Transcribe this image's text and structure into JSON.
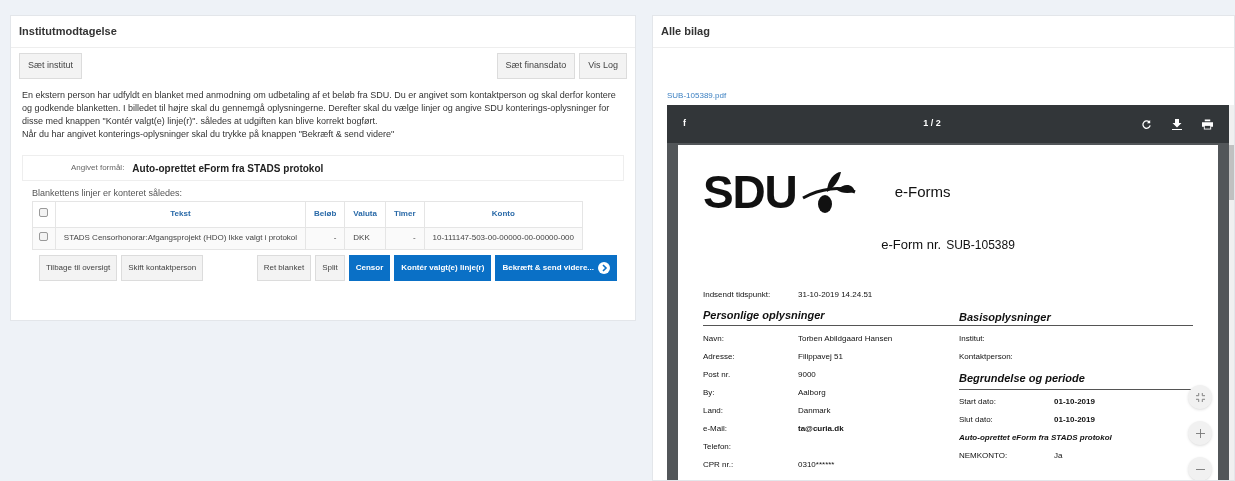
{
  "left_panel": {
    "title": "Institutmodtagelse",
    "toolbar_left": [
      "Sæt institut"
    ],
    "toolbar_right": [
      "Sæt finansdato",
      "Vis Log"
    ],
    "intro": [
      "En ekstern person har udfyldt en blanket med anmodning om udbetaling af et beløb fra SDU. Du er angivet som kontaktperson og skal derfor kontere og godkende blanketten. I billedet til højre skal du gennemgå oplysningerne. Derefter skal du vælge linjer og angive SDU konterings-oplysninger for disse med knappen \"Kontér valgt(e) linje(r)\". således at udgiften kan blive korrekt bogført.",
      "Når du har angivet konterings-oplysninger skal du trykke på knappen \"Bekræft & send videre\""
    ],
    "purpose": {
      "label": "Angivet formål:",
      "value": "Auto-oprettet eForm fra STADS protokol"
    },
    "table_caption": "Blankettens linjer er konteret således:",
    "table": {
      "header_checked": false,
      "columns": [
        "Tekst",
        "Beløb",
        "Valuta",
        "Timer",
        "Konto"
      ],
      "rows": [
        {
          "checked": false,
          "cells": [
            "STADS Censorhonorar:Afgangsprojekt (HDO) Ikke valgt i protokol",
            "-",
            "DKK",
            "-",
            "10-111147-503-00-00000-00-00000-000"
          ]
        }
      ]
    },
    "actions_left": [
      {
        "label": "Tilbage til oversigt",
        "kind": "default"
      },
      {
        "label": "Skift kontaktperson",
        "kind": "default"
      }
    ],
    "actions_right": [
      {
        "label": "Ret blanket",
        "kind": "default"
      },
      {
        "label": "Split",
        "kind": "default"
      },
      {
        "label": "Censor",
        "kind": "primary"
      },
      {
        "label": "Kontér valgt(e) linje(r)",
        "kind": "primary"
      },
      {
        "label": "Bekræft & send videre...",
        "kind": "primary-next"
      }
    ]
  },
  "right_panel": {
    "title": "Alle bilag",
    "file_link": "SUB-105389.pdf",
    "viewer": {
      "toolbar_left": "f",
      "page_indicator": "1 / 2",
      "document": {
        "logo_text": "SDU",
        "logo_subtitle": "e-Forms",
        "form_number_label": "e-Form nr.",
        "form_number": "SUB-105389",
        "submitted": {
          "label": "Indsendt tidspunkt:",
          "value": "31-10-2019 14.24.51"
        },
        "left_heading": "Personlige oplysninger",
        "left_rows": [
          {
            "label": "Navn:",
            "value": "Torben Abildgaard Hansen",
            "bold": false
          },
          {
            "label": "Adresse:",
            "value": "Filippavej 51",
            "bold": false
          },
          {
            "label": "Post nr.",
            "value": "9000",
            "bold": false
          },
          {
            "label": "By:",
            "value": "Aalborg",
            "bold": false
          },
          {
            "label": "Land:",
            "value": "Danmark",
            "bold": false
          },
          {
            "label": "e-Mail:",
            "value": "ta@curia.dk",
            "bold": true
          },
          {
            "label": "Telefon:"
          },
          {
            "label": "CPR nr.:",
            "value": "0310******",
            "bold": false
          }
        ],
        "right_heading": "Basisoplysninger",
        "right_items": [
          {
            "kind": "field",
            "label": "Institut:"
          },
          {
            "kind": "field",
            "label": "Kontaktperson:"
          },
          {
            "kind": "heading",
            "label": "Begrundelse og periode"
          },
          {
            "kind": "field",
            "label": "Start dato:",
            "value": "01-10-2019"
          },
          {
            "kind": "field",
            "label": "Slut dato:",
            "value": "01-10-2019"
          },
          {
            "kind": "note",
            "label": "Auto-oprettet eForm fra STADS protokol"
          },
          {
            "kind": "plainfield",
            "label": "NEMKONTO:",
            "value": "Ja"
          }
        ]
      }
    }
  }
}
